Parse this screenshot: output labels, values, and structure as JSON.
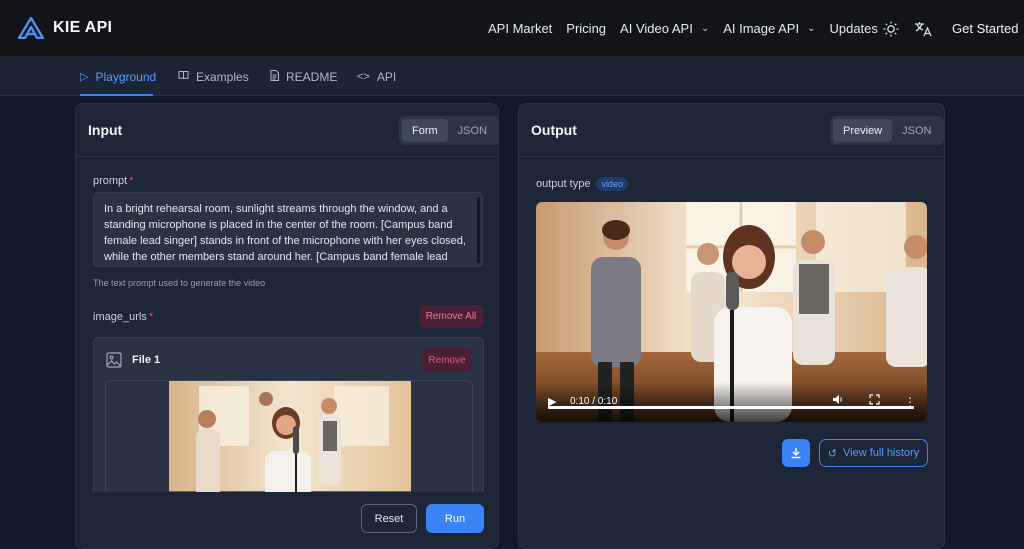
{
  "brand": {
    "name": "KIE API"
  },
  "nav": {
    "items": [
      {
        "label": "API Market"
      },
      {
        "label": "Pricing"
      },
      {
        "label": "AI Video API"
      },
      {
        "label": "AI Image API"
      },
      {
        "label": "Updates"
      }
    ],
    "get_started": "Get Started"
  },
  "tabs": [
    {
      "label": "Playground",
      "icon": "play-icon",
      "active": true
    },
    {
      "label": "Examples",
      "icon": "book-icon"
    },
    {
      "label": "README",
      "icon": "document-icon"
    },
    {
      "label": "API",
      "icon": "code-icon"
    }
  ],
  "input_panel": {
    "title": "Input",
    "toggle": {
      "form": "Form",
      "json": "JSON",
      "selected": "Form"
    },
    "prompt": {
      "label": "prompt",
      "required_mark": "*",
      "value": "In a bright rehearsal room, sunlight streams through the window, and a standing microphone is placed in the center of the room. [Campus band female lead singer] stands in front of the microphone with her eyes closed, while the other members stand around her. [Campus band female lead singer, full voice] leads: \"I will try to fix you, with all my heart and soul...\" The",
      "helper": "The text prompt used to generate the video"
    },
    "image_urls": {
      "label": "image_urls",
      "required_mark": "*",
      "remove_all": "Remove All",
      "file": {
        "name": "File 1",
        "remove": "Remove"
      }
    },
    "reset": "Reset",
    "run": "Run"
  },
  "output_panel": {
    "title": "Output",
    "toggle": {
      "preview": "Preview",
      "json": "JSON",
      "selected": "Preview"
    },
    "output_type_label": "output type",
    "output_type_tag": "video",
    "video": {
      "time": "0:10 / 0:10",
      "progress": 1.0
    },
    "view_history": "View full history"
  },
  "colors": {
    "accent": "#3b82f6",
    "danger": "#ef4f6d"
  }
}
